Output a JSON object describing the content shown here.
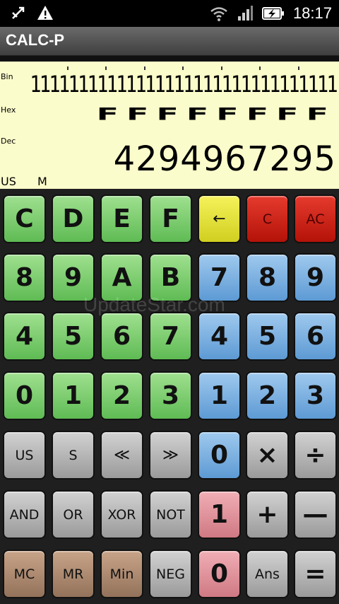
{
  "status_bar": {
    "time": "18:17",
    "icons": [
      "usb-debug-icon",
      "warning-icon",
      "wifi-icon",
      "signal-icon",
      "battery-charging-icon"
    ]
  },
  "app": {
    "title": "CALC-P"
  },
  "display": {
    "labels": {
      "bin": "Bin",
      "hex": "Hex",
      "dec": "Dec"
    },
    "bin_value": "11111111111111111111111111111111",
    "hex_value": "FFFFFFFF",
    "dec_value": "4294967295",
    "mode_indicator": "US",
    "memory_indicator": "M"
  },
  "watermark": "UpdateStar.com",
  "keys": [
    [
      {
        "label": "C",
        "name": "hex-c-button",
        "color": "green",
        "size": "big"
      },
      {
        "label": "D",
        "name": "hex-d-button",
        "color": "green",
        "size": "big"
      },
      {
        "label": "E",
        "name": "hex-e-button",
        "color": "green",
        "size": "big"
      },
      {
        "label": "F",
        "name": "hex-f-button",
        "color": "green",
        "size": "big"
      },
      {
        "label": "←",
        "name": "backspace-button",
        "color": "yellow",
        "size": "med"
      },
      {
        "label": "C",
        "name": "clear-button",
        "color": "red",
        "size": "sm"
      },
      {
        "label": "AC",
        "name": "all-clear-button",
        "color": "red",
        "size": "sm"
      }
    ],
    [
      {
        "label": "8",
        "name": "hex-8-button",
        "color": "green",
        "size": "big"
      },
      {
        "label": "9",
        "name": "hex-9-button",
        "color": "green",
        "size": "big"
      },
      {
        "label": "A",
        "name": "hex-a-button",
        "color": "green",
        "size": "big"
      },
      {
        "label": "B",
        "name": "hex-b-button",
        "color": "green",
        "size": "big"
      },
      {
        "label": "7",
        "name": "dec-7-button",
        "color": "blue",
        "size": "big"
      },
      {
        "label": "8",
        "name": "dec-8-button",
        "color": "blue",
        "size": "big"
      },
      {
        "label": "9",
        "name": "dec-9-button",
        "color": "blue",
        "size": "big"
      }
    ],
    [
      {
        "label": "4",
        "name": "hex-4-button",
        "color": "green",
        "size": "big"
      },
      {
        "label": "5",
        "name": "hex-5-button",
        "color": "green",
        "size": "big"
      },
      {
        "label": "6",
        "name": "hex-6-button",
        "color": "green",
        "size": "big"
      },
      {
        "label": "7",
        "name": "hex-7-button",
        "color": "green",
        "size": "big"
      },
      {
        "label": "4",
        "name": "dec-4-button",
        "color": "blue",
        "size": "big"
      },
      {
        "label": "5",
        "name": "dec-5-button",
        "color": "blue",
        "size": "big"
      },
      {
        "label": "6",
        "name": "dec-6-button",
        "color": "blue",
        "size": "big"
      }
    ],
    [
      {
        "label": "0",
        "name": "hex-0-button",
        "color": "green",
        "size": "big"
      },
      {
        "label": "1",
        "name": "hex-1-button",
        "color": "green",
        "size": "big"
      },
      {
        "label": "2",
        "name": "hex-2-button",
        "color": "green",
        "size": "big"
      },
      {
        "label": "3",
        "name": "hex-3-button",
        "color": "green",
        "size": "big"
      },
      {
        "label": "1",
        "name": "dec-1-button",
        "color": "blue",
        "size": "big"
      },
      {
        "label": "2",
        "name": "dec-2-button",
        "color": "blue",
        "size": "big"
      },
      {
        "label": "3",
        "name": "dec-3-button",
        "color": "blue",
        "size": "big"
      }
    ],
    [
      {
        "label": "US",
        "name": "unsigned-button",
        "color": "gray",
        "size": "sm"
      },
      {
        "label": "S",
        "name": "signed-button",
        "color": "gray",
        "size": "sm"
      },
      {
        "label": "≪",
        "name": "shift-left-button",
        "color": "gray",
        "size": "med"
      },
      {
        "label": "≫",
        "name": "shift-right-button",
        "color": "gray",
        "size": "med"
      },
      {
        "label": "0",
        "name": "dec-0-button",
        "color": "blue",
        "size": "big"
      },
      {
        "label": "×",
        "name": "multiply-button",
        "color": "gray",
        "size": "big"
      },
      {
        "label": "÷",
        "name": "divide-button",
        "color": "gray",
        "size": "big"
      }
    ],
    [
      {
        "label": "AND",
        "name": "and-button",
        "color": "gray",
        "size": "sm"
      },
      {
        "label": "OR",
        "name": "or-button",
        "color": "gray",
        "size": "sm"
      },
      {
        "label": "XOR",
        "name": "xor-button",
        "color": "gray",
        "size": "sm"
      },
      {
        "label": "NOT",
        "name": "not-button",
        "color": "gray",
        "size": "sm"
      },
      {
        "label": "1",
        "name": "bin-1-button",
        "color": "pink",
        "size": "big"
      },
      {
        "label": "+",
        "name": "plus-button",
        "color": "gray",
        "size": "big"
      },
      {
        "label": "—",
        "name": "minus-button",
        "color": "gray",
        "size": "big"
      }
    ],
    [
      {
        "label": "MC",
        "name": "memory-clear-button",
        "color": "brown",
        "size": "sm"
      },
      {
        "label": "MR",
        "name": "memory-recall-button",
        "color": "brown",
        "size": "sm"
      },
      {
        "label": "Min",
        "name": "memory-in-button",
        "color": "brown",
        "size": "sm"
      },
      {
        "label": "NEG",
        "name": "negate-button",
        "color": "gray",
        "size": "sm"
      },
      {
        "label": "0",
        "name": "bin-0-button",
        "color": "pink",
        "size": "big"
      },
      {
        "label": "Ans",
        "name": "answer-button",
        "color": "gray",
        "size": "sm"
      },
      {
        "label": "=",
        "name": "equals-button",
        "color": "gray",
        "size": "big"
      }
    ]
  ]
}
